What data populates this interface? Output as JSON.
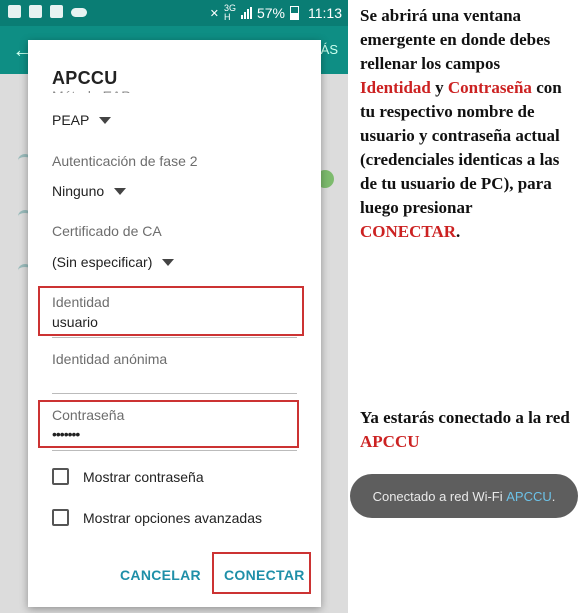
{
  "status_bar": {
    "network_type": "3G",
    "network_sub": "H",
    "battery_percent": "57%",
    "time": "11:13",
    "left_icons": [
      "screenshot-icon",
      "image-icon",
      "mail-icon",
      "cloud-icon"
    ]
  },
  "appbar": {
    "overflow_text": "ÁS"
  },
  "dialog": {
    "title": "APCCU",
    "eap_method_label": "Método EAP",
    "eap_method_value": "PEAP",
    "phase2_label": "Autenticación de fase 2",
    "phase2_value": "Ninguno",
    "ca_cert_label": "Certificado de CA",
    "ca_cert_value": "(Sin especificar)",
    "identity_label": "Identidad",
    "identity_value": "usuario",
    "anon_identity_label": "Identidad anónima",
    "anon_identity_value": "",
    "password_label": "Contraseña",
    "password_value": "•••••••",
    "show_password_label": "Mostrar contraseña",
    "show_password_checked": false,
    "advanced_label": "Mostrar opciones avanzadas",
    "advanced_checked": false,
    "cancel_label": "CANCELAR",
    "connect_label": "CONECTAR"
  },
  "instructions": {
    "p1_a": "Se abrirá una ventana emergente en donde debes rellenar los campos",
    "p1_identity": "Identidad",
    "p1_b": "y",
    "p1_password": "Contraseña",
    "p1_c": "con tu respectivo nombre de usuario y contraseña actual (credenciales identicas a las de tu usuario de PC), para luego presionar",
    "p1_connect": "CONECTAR",
    "p1_end": ".",
    "p2_a": "Ya estarás conectado a la red",
    "p2_network": "APCCU"
  },
  "toast": {
    "text": "Conectado a red Wi-Fi",
    "network": "APCCU",
    "end": "."
  },
  "colors": {
    "teal": "#0e8e84",
    "highlight_red": "#cc3333",
    "button_blue": "#1f8fa8",
    "instruction_red": "#cc2222"
  }
}
